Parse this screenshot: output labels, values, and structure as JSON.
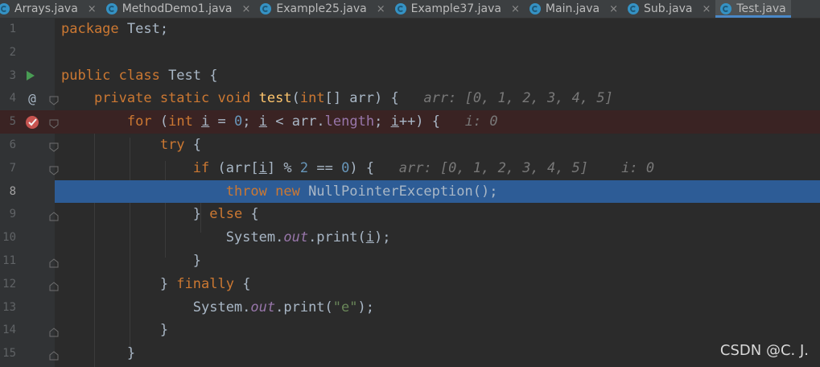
{
  "tabs": [
    {
      "label": "Arrays.java",
      "active": false,
      "icon": "java-class-icon"
    },
    {
      "label": "MethodDemo1.java",
      "active": false,
      "icon": "java-class-icon"
    },
    {
      "label": "Example25.java",
      "active": false,
      "icon": "java-class-icon"
    },
    {
      "label": "Example37.java",
      "active": false,
      "icon": "java-class-icon"
    },
    {
      "label": "Main.java",
      "active": false,
      "icon": "java-class-icon"
    },
    {
      "label": "Sub.java",
      "active": false,
      "icon": "java-class-icon"
    },
    {
      "label": "Test.java",
      "active": true,
      "icon": "java-class-icon"
    }
  ],
  "tab_close_glyph": "×",
  "line_numbers": [
    "1",
    "2",
    "3",
    "4",
    "5",
    "6",
    "7",
    "8",
    "9",
    "10",
    "11",
    "12",
    "13",
    "14",
    "15"
  ],
  "current_line": "8",
  "breakpoint_line": "5",
  "hints": {
    "line4": "arr: [0, 1, 2, 3, 4, 5]",
    "line5": "i: 0",
    "line7a": "arr: [0, 1, 2, 3, 4, 5]",
    "line7b": "i: 0"
  },
  "watermark": "CSDN @C.  J.",
  "colors": {
    "background": "#2b2b2b",
    "keyword": "#cc7832",
    "method": "#ffc66d",
    "number": "#6897bb",
    "string": "#6a8759",
    "field": "#9876aa",
    "execution_line": "#2d5c96",
    "breakpoint_line": "#3a2323"
  }
}
